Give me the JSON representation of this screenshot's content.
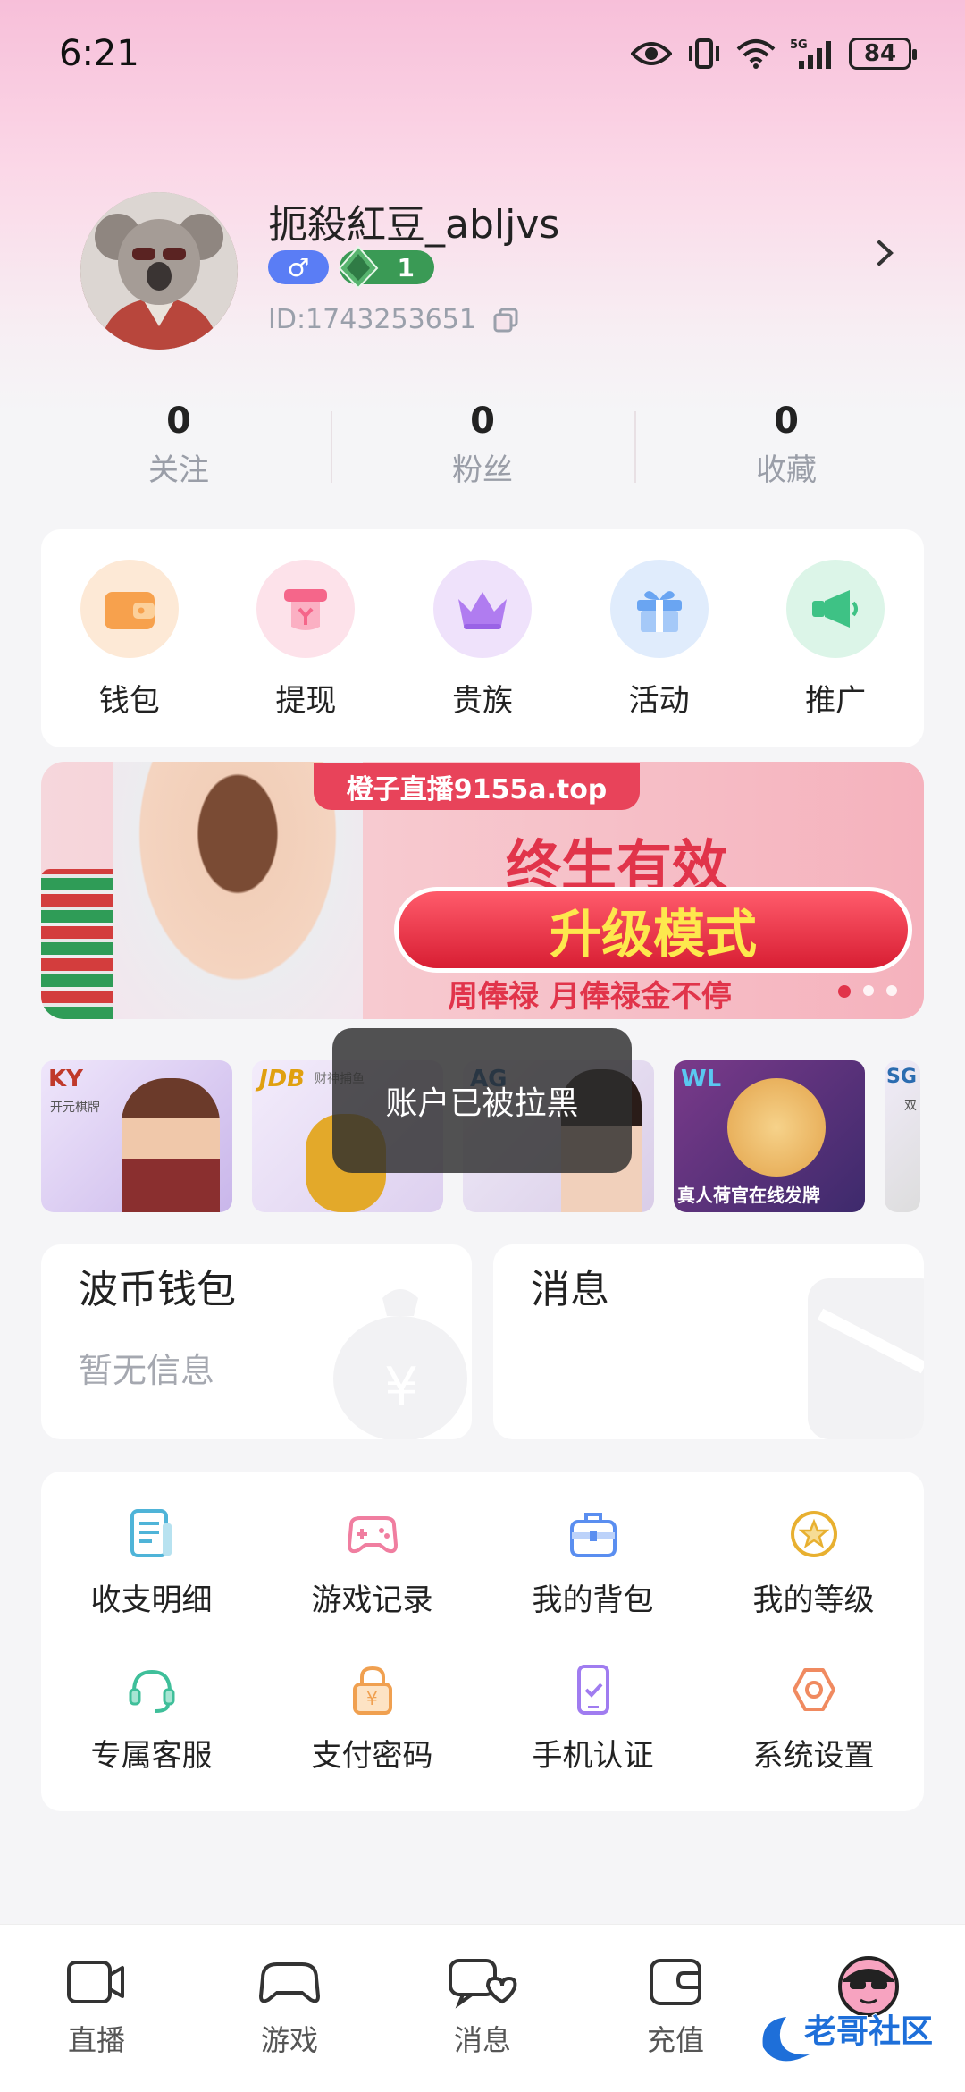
{
  "status": {
    "time": "6:21",
    "battery": "84",
    "network": "5G"
  },
  "profile": {
    "username": "扼殺紅豆_abljvs",
    "gender_symbol": "♂",
    "level": "1",
    "user_id": "ID:1743253651"
  },
  "stats": [
    {
      "value": "0",
      "label": "关注"
    },
    {
      "value": "0",
      "label": "粉丝"
    },
    {
      "value": "0",
      "label": "收藏"
    }
  ],
  "quick_actions": [
    {
      "label": "钱包",
      "icon": "wallet-icon",
      "color": "#f7a14d"
    },
    {
      "label": "提现",
      "icon": "withdraw-icon",
      "color": "#f5668a"
    },
    {
      "label": "贵族",
      "icon": "crown-icon",
      "color": "#b07cf0"
    },
    {
      "label": "活动",
      "icon": "gift-icon",
      "color": "#6aa5f2"
    },
    {
      "label": "推广",
      "icon": "megaphone-icon",
      "color": "#3ec285"
    }
  ],
  "banner": {
    "tag": "橙子直播9155a.top",
    "title": "终生有效",
    "button": "升级模式",
    "subtitle": "周俸禄 月俸禄金不停"
  },
  "games": [
    {
      "logo": "KY",
      "sub": "开元棋牌"
    },
    {
      "logo": "JDB",
      "sub": "财神捕鱼"
    },
    {
      "logo": "AG",
      "sub": ""
    },
    {
      "logo": "WL",
      "sub": "真人荷官在线发牌"
    },
    {
      "logo": "SG",
      "sub": "双"
    }
  ],
  "toast": "账户已被拉黑",
  "wallet_card": {
    "title": "波币钱包",
    "subtitle": "暂无信息"
  },
  "message_card": {
    "title": "消息"
  },
  "tools": [
    {
      "label": "收支明细",
      "icon": "ledger-icon",
      "color": "#4fb4d8"
    },
    {
      "label": "游戏记录",
      "icon": "gamepad-icon",
      "color": "#f07ea0"
    },
    {
      "label": "我的背包",
      "icon": "backpack-icon",
      "color": "#5a8ef0"
    },
    {
      "label": "我的等级",
      "icon": "star-level-icon",
      "color": "#e8b030"
    },
    {
      "label": "专属客服",
      "icon": "headset-icon",
      "color": "#3fbf9a"
    },
    {
      "label": "支付密码",
      "icon": "lock-icon",
      "color": "#f0a050"
    },
    {
      "label": "手机认证",
      "icon": "phone-check-icon",
      "color": "#a07cf0"
    },
    {
      "label": "系统设置",
      "icon": "settings-icon",
      "color": "#f08a60"
    }
  ],
  "tabs": [
    {
      "label": "直播",
      "icon": "live-icon"
    },
    {
      "label": "游戏",
      "icon": "game-icon"
    },
    {
      "label": "消息",
      "icon": "message-icon"
    },
    {
      "label": "充值",
      "icon": "recharge-icon"
    },
    {
      "label": "",
      "icon": "profile-avatar-icon"
    }
  ],
  "watermark": "老哥社区"
}
